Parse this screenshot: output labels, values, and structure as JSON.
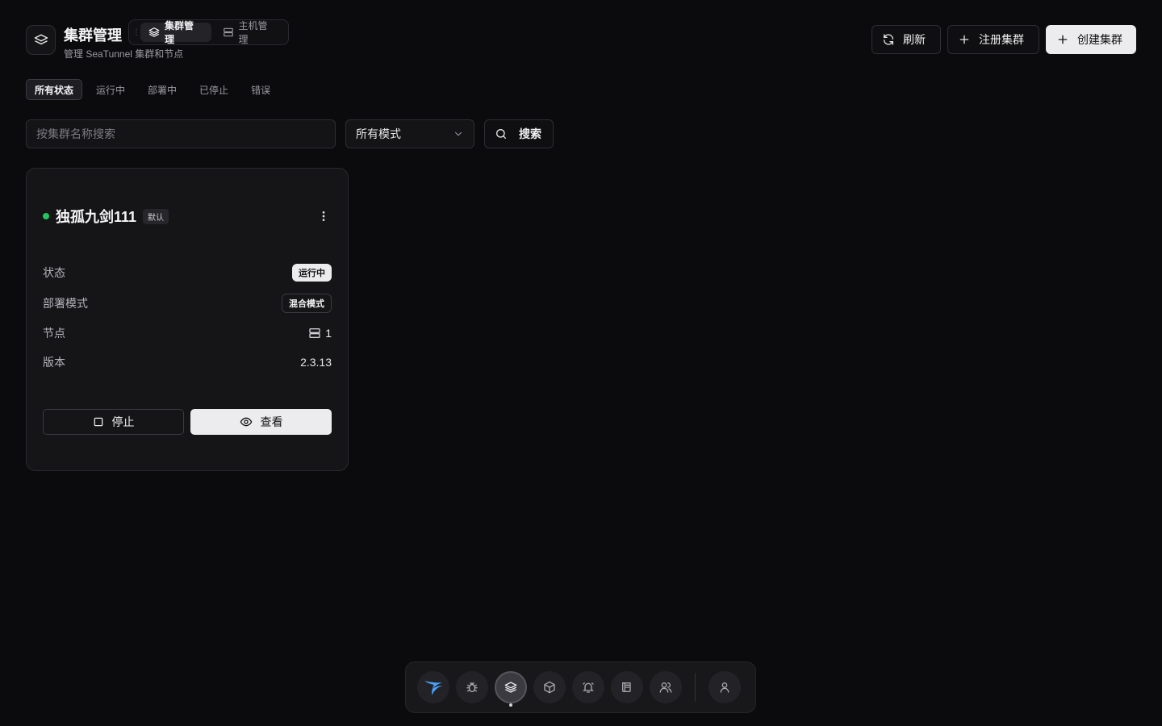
{
  "header": {
    "title": "集群管理",
    "subtitle": "管理 SeaTunnel 集群和节点",
    "tabs": [
      {
        "label": "集群管理",
        "active": true,
        "icon": "layers-icon"
      },
      {
        "label": "主机管理",
        "active": false,
        "icon": "server-icon"
      }
    ]
  },
  "actions": {
    "refresh_label": "刷新",
    "register_label": "注册集群",
    "create_label": "创建集群"
  },
  "status_filters": [
    {
      "label": "所有状态",
      "active": true
    },
    {
      "label": "运行中",
      "active": false
    },
    {
      "label": "部署中",
      "active": false
    },
    {
      "label": "已停止",
      "active": false
    },
    {
      "label": "错误",
      "active": false
    }
  ],
  "search": {
    "placeholder": "按集群名称搜索",
    "value": "",
    "mode_selected": "所有模式",
    "button_label": "搜索"
  },
  "cluster_card": {
    "name": "独孤九剑111",
    "default_badge": "默认",
    "status_color": "#22c55e",
    "rows": {
      "status_label": "状态",
      "status_value": "运行中",
      "mode_label": "部署模式",
      "mode_value": "混合模式",
      "nodes_label": "节点",
      "nodes_value": "1",
      "version_label": "版本",
      "version_value": "2.3.13"
    },
    "stop_label": "停止",
    "view_label": "查看"
  },
  "dock": {
    "items": [
      "seatunnel-logo-icon",
      "bug-icon",
      "layers-icon",
      "package-icon",
      "bell-icon",
      "scroll-icon",
      "users-icon"
    ],
    "active": "layers-icon",
    "profile": "user-icon"
  }
}
